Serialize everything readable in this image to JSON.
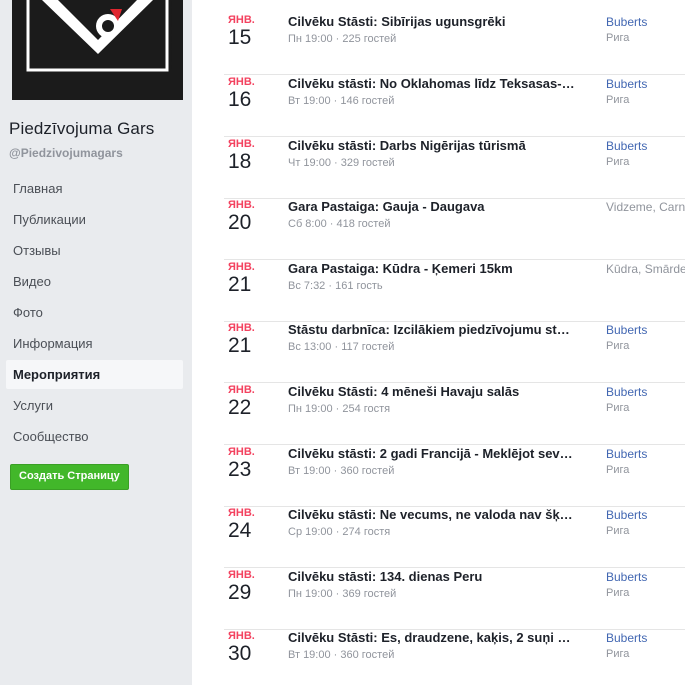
{
  "page": {
    "name": "Piedzīvojuma Gars",
    "handle": "@Piedzivojumagars"
  },
  "sidebar": {
    "items": [
      {
        "label": "Главная",
        "active": false
      },
      {
        "label": "Публикации",
        "active": false
      },
      {
        "label": "Отзывы",
        "active": false
      },
      {
        "label": "Видео",
        "active": false
      },
      {
        "label": "Фото",
        "active": false
      },
      {
        "label": "Информация",
        "active": false
      },
      {
        "label": "Мероприятия",
        "active": true
      },
      {
        "label": "Услуги",
        "active": false
      },
      {
        "label": "Сообщество",
        "active": false
      }
    ],
    "create_page_label": "Создать Страницу"
  },
  "events": [
    {
      "month": "ЯНВ.",
      "day": "15",
      "title": "Cilvēku Stāsti: Sibīrijas ugunsgrēki",
      "meta": "Пн 19:00 · 225 гостей",
      "place": "Buberts",
      "city": "Рига"
    },
    {
      "month": "ЯНВ.",
      "day": "16",
      "title": "Cilvēku stāsti: No Oklahomas līdz Teksasas-…",
      "meta": "Вт 19:00 · 146 гостей",
      "place": "Buberts",
      "city": "Рига"
    },
    {
      "month": "ЯНВ.",
      "day": "18",
      "title": "Cilvēku stāsti: Darbs Nigērijas tūrismā",
      "meta": "Чт 19:00 · 329 гостей",
      "place": "Buberts",
      "city": "Рига"
    },
    {
      "month": "ЯНВ.",
      "day": "20",
      "title": "Gara Pastaiga: Gauja - Daugava",
      "meta": "Сб 8:00 · 418 гостей",
      "place": "Vidzeme, Carni",
      "city": ""
    },
    {
      "month": "ЯНВ.",
      "day": "21",
      "title": "Gara Pastaiga: Kūdra - Ķemeri 15km",
      "meta": "Вс 7:32 · 161 гость",
      "place": "Kūdra, Smārde",
      "city": ""
    },
    {
      "month": "ЯНВ.",
      "day": "21",
      "title": "Stāstu darbnīca: Izcilākiem piedzīvojumu st…",
      "meta": "Вс 13:00 · 117 гостей",
      "place": "Buberts",
      "city": "Рига"
    },
    {
      "month": "ЯНВ.",
      "day": "22",
      "title": "Cilvēku Stāsti: 4 mēneši Havaju salās",
      "meta": "Пн 19:00 · 254 гостя",
      "place": "Buberts",
      "city": "Рига"
    },
    {
      "month": "ЯНВ.",
      "day": "23",
      "title": "Cilvēku stāsti: 2 gadi Francijā - Meklējot sev…",
      "meta": "Вт 19:00 · 360 гостей",
      "place": "Buberts",
      "city": "Рига"
    },
    {
      "month": "ЯНВ.",
      "day": "24",
      "title": "Cilvēku stāsti: Ne vecums, ne valoda nav šķ…",
      "meta": "Ср 19:00 · 274 гостя",
      "place": "Buberts",
      "city": "Рига"
    },
    {
      "month": "ЯНВ.",
      "day": "29",
      "title": "Cilvēku stāsti: 134. dienas Peru",
      "meta": "Пн 19:00 · 369 гостей",
      "place": "Buberts",
      "city": "Рига"
    },
    {
      "month": "ЯНВ.",
      "day": "30",
      "title": "Cilvēku Stāsti: Es, draudzene, kaķis, 2 suņi …",
      "meta": "Вт 19:00 · 360 гостей",
      "place": "Buberts",
      "city": "Рига"
    }
  ]
}
